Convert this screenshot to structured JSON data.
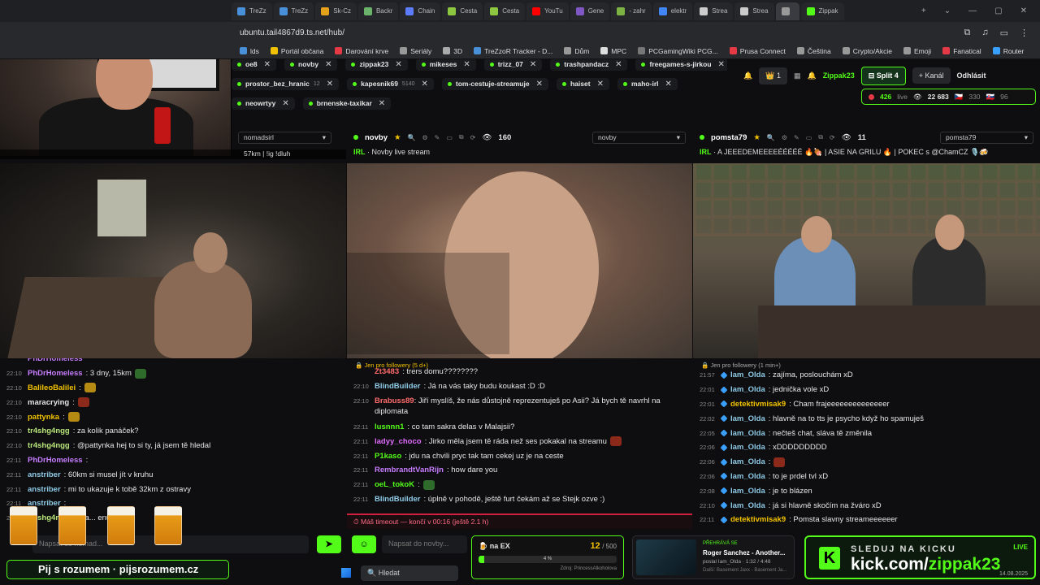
{
  "browser": {
    "tabs": [
      {
        "label": "TreZz",
        "color": "#4a90d9"
      },
      {
        "label": "TreZz",
        "color": "#4a90d9"
      },
      {
        "label": "Sk-Cz",
        "color": "#e3a21a"
      },
      {
        "label": "Backr",
        "color": "#6bb36b"
      },
      {
        "label": "Chain",
        "color": "#5c7cfa"
      },
      {
        "label": "Cesta",
        "color": "#8dc63f"
      },
      {
        "label": "Cesta",
        "color": "#8dc63f"
      },
      {
        "label": "YouTu",
        "color": "#ff0000"
      },
      {
        "label": "Gene",
        "color": "#7e57c2"
      },
      {
        "label": "- zahr",
        "color": "#7cb342"
      },
      {
        "label": "elektr",
        "color": "#4285f4"
      },
      {
        "label": "Strea",
        "color": "#cccccc"
      },
      {
        "label": "Strea",
        "color": "#cccccc"
      },
      {
        "label": "",
        "color": "#999999"
      },
      {
        "label": "Zippak",
        "color": "#53fc18"
      }
    ],
    "url": "ubuntu.tail4867d9.ts.net/hub/",
    "bookmarks": [
      "lds",
      "Portál občana",
      "Darování krve",
      "Seriály",
      "3D",
      "TreZzoR Tracker - D...",
      "Dům",
      "MPC",
      "PCGamingWiki PCG...",
      "Prusa Connect",
      "Čeština",
      "Crypto/Akcie",
      "Emoji",
      "Fanatical",
      "Router"
    ]
  },
  "chips": {
    "row1": [
      {
        "name": "oe8",
        "count": ""
      },
      {
        "name": "novby",
        "count": ""
      },
      {
        "name": "zippak23",
        "count": ""
      },
      {
        "name": "mikeses",
        "count": ""
      },
      {
        "name": "trizz_07",
        "count": ""
      },
      {
        "name": "trashpandacz",
        "count": ""
      },
      {
        "name": "freegames-s-jirkou",
        "count": ""
      }
    ],
    "row2": [
      {
        "name": "prostor_bez_hranic",
        "count": "12"
      },
      {
        "name": "kapesnik69",
        "count": "5140"
      },
      {
        "name": "tom-cestuje-streamuje",
        "count": ""
      },
      {
        "name": "haiset",
        "count": ""
      },
      {
        "name": "maho-irl",
        "count": ""
      }
    ],
    "row3": [
      {
        "name": "neowrtyy",
        "count": ""
      },
      {
        "name": "brnenske-taxikar",
        "count": ""
      }
    ]
  },
  "topright": {
    "count": "1",
    "brand": "Zippak23",
    "split": "Split 4",
    "channel": "+ Kanál",
    "logout": "Odhlásit",
    "viewers_live": "426",
    "live_label": "live",
    "total": "22 683",
    "cz": "330",
    "sk": "96"
  },
  "streams": [
    {
      "channel": "nomadsirl",
      "viewers": "",
      "category": "",
      "title": "",
      "select": "nomadsirl"
    },
    {
      "channel": "novby",
      "viewers": "160",
      "category": "IRL",
      "title": "Novby live stream",
      "select": "novby"
    },
    {
      "channel": "pomsta79",
      "viewers": "11",
      "category": "IRL",
      "title": "A JEEEDEMEEEEÉÉÉÉÉ 🔥🍖 | ASIE NA GRILU 🔥 | POKEC s @ChamCZ 🎙️🍻",
      "select": "pomsta79"
    }
  ],
  "caption": "57km | !ig !dluh",
  "chat1": [
    {
      "time": "",
      "user": "PhDrHomeless",
      "color": "#c77dff",
      "text": "",
      "emote": ""
    },
    {
      "time": "22:10",
      "user": "PhDrHomeless",
      "color": "#c77dff",
      "text": ": 3 dny, 15km",
      "emote": "green"
    },
    {
      "time": "22:10",
      "user": "BalileoBalilei",
      "color": "#f2c200",
      "text": ":",
      "emote": "yel"
    },
    {
      "time": "22:10",
      "user": "maracrying",
      "color": "#e6e6e6",
      "text": ":",
      "emote": "red"
    },
    {
      "time": "22:10",
      "user": "pattynka",
      "color": "#f2c200",
      "text": ":",
      "emote": "yel"
    },
    {
      "time": "22:10",
      "user": "tr4shg4ngg",
      "color": "#b9e67a",
      "text": ": za kolik panáček?",
      "emote": ""
    },
    {
      "time": "22:10",
      "user": "tr4shg4ngg",
      "color": "#b9e67a",
      "text": ": @pattynka hej to si ty, já jsem tě hledal",
      "emote": ""
    },
    {
      "time": "22:11",
      "user": "PhDrHomeless",
      "color": "#c77dff",
      "text": ":",
      "emote": ""
    },
    {
      "time": "22:11",
      "user": "anstriber",
      "color": "#8ecae6",
      "text": ": 60km si musel jít v kruhu",
      "emote": ""
    },
    {
      "time": "22:11",
      "user": "anstriber",
      "color": "#8ecae6",
      "text": ": mi to ukazuje k tobě 32km z ostravy",
      "emote": ""
    },
    {
      "time": "22:11",
      "user": "anstriber",
      "color": "#8ecae6",
      "text": ":",
      "emote": ""
    },
    {
      "time": "22:11",
      "user": "tr4shg4ngg",
      "color": "#b9e67a",
      "text": ": vša... enu",
      "emote": ""
    }
  ],
  "chat2": {
    "pill": "Jen pro followery (5 d+)",
    "messages": [
      {
        "time": "",
        "user": "Zt3483",
        "color": "#ff6b6b",
        "text": ": trers domu????????",
        "emote": ""
      },
      {
        "time": "22:10",
        "user": "BlindBuilder",
        "color": "#8ecae6",
        "text": ": Já na vás taky budu koukast :D :D",
        "emote": ""
      },
      {
        "time": "22:10",
        "user": "Brabuss89",
        "color": "#ff6b6b",
        "text": ": Jiří myslíš, že nás důstojně reprezentuješ po Asii? Já bych tě navrhl na diplomata",
        "emote": "",
        "wrap": true
      },
      {
        "time": "22:11",
        "user": "lusnnn1",
        "color": "#53fc18",
        "text": ": co tam sakra delas v Malajsii?",
        "emote": ""
      },
      {
        "time": "22:11",
        "user": "ladyy_choco",
        "color": "#e06bff",
        "text": ": Jirko měla jsem tě ráda než ses pokakal na streamu",
        "emote": "red"
      },
      {
        "time": "22:11",
        "user": "P1kaso",
        "color": "#53fc18",
        "text": ": jdu na chvili pryc tak tam cekej uz je na ceste",
        "emote": ""
      },
      {
        "time": "22:11",
        "user": "RembrandtVanRijn",
        "color": "#c77dff",
        "text": ": how dare you",
        "emote": ""
      },
      {
        "time": "22:11",
        "user": "oeL_tokoK",
        "color": "#53fc18",
        "text": ":",
        "emote": "green"
      },
      {
        "time": "22:11",
        "user": "BlindBuilder",
        "color": "#8ecae6",
        "text": ": úplně v pohodě, ještě furt čekám až se Stejk ozve :)",
        "emote": ""
      }
    ],
    "timeout": "Máš timeout — končí v 00:16 (ještě 2.1 h)"
  },
  "chat3": {
    "pill": "Jen pro followery (1 min+)",
    "messages": [
      {
        "time": "21:57",
        "user": "Iam_Olda",
        "color": "#8ecae6",
        "text": ": zajíma, poslouchám xD",
        "emote": ""
      },
      {
        "time": "22:01",
        "user": "Iam_Olda",
        "color": "#8ecae6",
        "text": ": jednička vole xD",
        "emote": ""
      },
      {
        "time": "22:01",
        "user": "detektivmisak9",
        "color": "#f2c200",
        "text": ": Cham frajeeeeeeeeeeeeeer",
        "emote": ""
      },
      {
        "time": "22:02",
        "user": "Iam_Olda",
        "color": "#8ecae6",
        "text": ": hlavně na to tts je psycho když ho spamuješ",
        "emote": ""
      },
      {
        "time": "22:05",
        "user": "Iam_Olda",
        "color": "#8ecae6",
        "text": ": nečteš chat, sláva tě změnila",
        "emote": ""
      },
      {
        "time": "22:06",
        "user": "Iam_Olda",
        "color": "#8ecae6",
        "text": ": xDDDDDDDDD",
        "emote": ""
      },
      {
        "time": "22:06",
        "user": "Iam_Olda",
        "color": "#8ecae6",
        "text": ":",
        "emote": "red"
      },
      {
        "time": "22:06",
        "user": "Iam_Olda",
        "color": "#8ecae6",
        "text": ": to je prdel tvl xD",
        "emote": ""
      },
      {
        "time": "22:08",
        "user": "Iam_Olda",
        "color": "#8ecae6",
        "text": ": je to blázen",
        "emote": ""
      },
      {
        "time": "22:10",
        "user": "Iam_Olda",
        "color": "#8ecae6",
        "text": ": já si hlavně skočím na žváro xD",
        "emote": ""
      },
      {
        "time": "22:11",
        "user": "detektivmisak9",
        "color": "#f2c200",
        "text": ": Pomsta slavny streameeeeeer",
        "emote": ""
      }
    ]
  },
  "bottom": {
    "placeholder1": "Napsat do nomad...",
    "placeholder2": "Napsat do novby...",
    "pij": "Pij s rozumem · pijsrozumem.cz",
    "search": "Hledat",
    "goal_label": "na EX",
    "goal_current": "12",
    "goal_total": "/ 500",
    "goal_pct": "4 %",
    "goal_fraction": 0.04,
    "goal_footer": "Zdroj: PrincessAlkoholova",
    "np_tag": "PŘEHRÁVÁ SE",
    "np_title": "Roger Sanchez - Another...",
    "np_by": "poslal Iam_Olda",
    "np_time": "1:32 / 4:48",
    "np_next": "Další: Basement Jaxx - Basement Ja...",
    "kick_top": "SLEDUJ NA KICKU",
    "kick_url_a": "kick.com/",
    "kick_url_b": "zippak23",
    "kick_live": "LIVE",
    "clock": "14.08.2025"
  }
}
